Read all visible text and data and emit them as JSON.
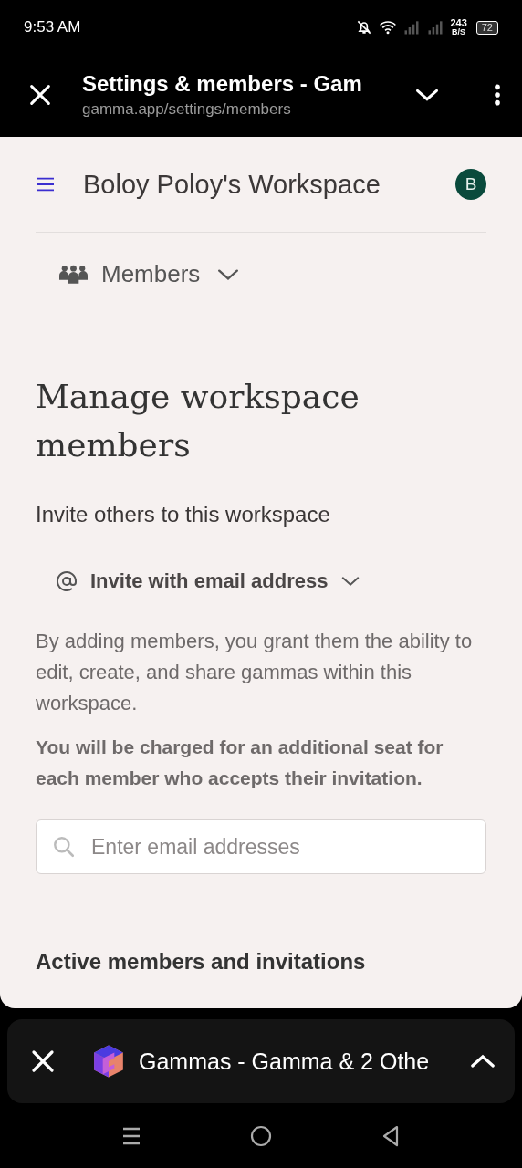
{
  "status_bar": {
    "time": "9:53 AM",
    "net_speed": "243",
    "net_unit": "B/S",
    "battery": "72"
  },
  "browser_bar": {
    "title": "Settings & members - Gam",
    "url": "gamma.app/settings/members"
  },
  "header": {
    "workspace": "Boloy Poloy's Workspace",
    "avatar": "B"
  },
  "section_menu": {
    "label": "Members"
  },
  "heading": "Manage workspace members",
  "invite_title": "Invite others to this workspace",
  "invite_method": {
    "label": "Invite with email address"
  },
  "description": "By adding members, you grant them the ability to edit, create, and share gammas within this workspace.",
  "warning": "You will be charged for an additional seat for each member who accepts their invitation.",
  "email_field": {
    "placeholder": "Enter email addresses"
  },
  "members_title": "Active members and invitations",
  "tab_bar": {
    "title": "Gammas - Gamma & 2 Othe"
  }
}
